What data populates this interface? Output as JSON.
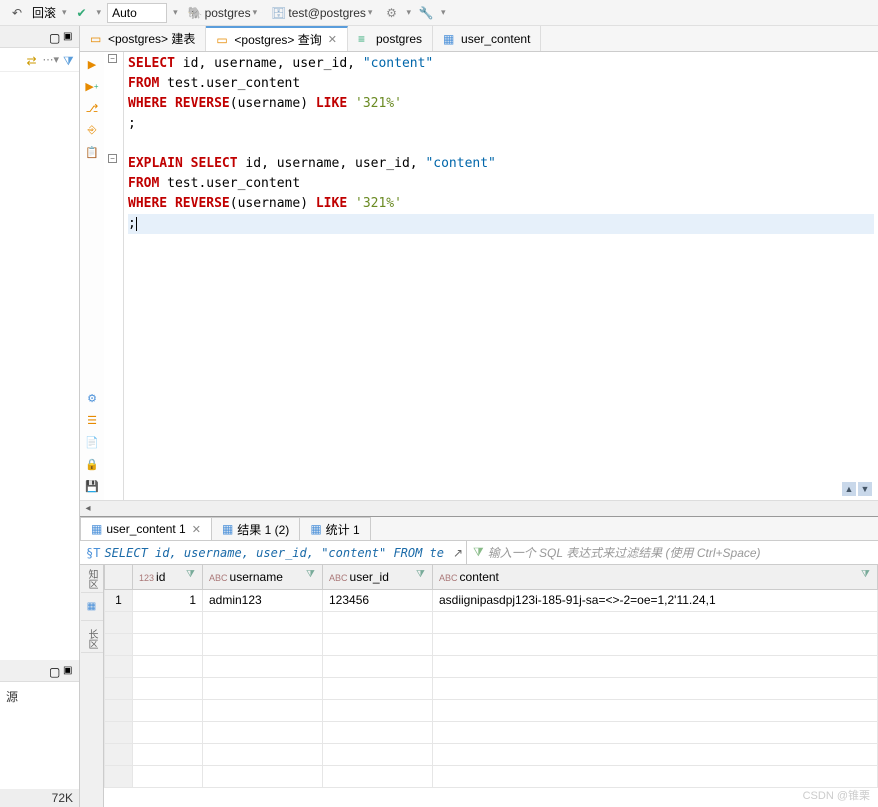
{
  "toolbar": {
    "rollback_label": "回滚",
    "combo_value": "Auto",
    "db_label": "postgres",
    "conn_label": "test@postgres"
  },
  "left": {
    "stat": "72K",
    "bottom_label": "源"
  },
  "tabs": [
    {
      "label": "<postgres> 建表",
      "active": false,
      "closeable": false
    },
    {
      "label": "<postgres> 查询",
      "active": true,
      "closeable": true
    },
    {
      "label": "postgres",
      "active": false,
      "closeable": false
    },
    {
      "label": "user_content",
      "active": false,
      "closeable": false
    }
  ],
  "sql": {
    "lines": [
      {
        "type": "sql1",
        "tokens": [
          "SELECT",
          " id, username, user_id, ",
          "\"content\""
        ]
      },
      {
        "type": "sql1b",
        "tokens": [
          "FROM",
          " test.user_content"
        ]
      },
      {
        "type": "sql1c",
        "tokens": [
          "WHERE",
          " ",
          "REVERSE",
          "(username) ",
          "LIKE",
          " ",
          "'321%'"
        ]
      },
      {
        "type": "semi",
        "tokens": [
          ";"
        ]
      },
      {
        "type": "blank"
      },
      {
        "type": "sql2",
        "tokens": [
          "EXPLAIN",
          " ",
          "SELECT",
          " id, username, user_id, ",
          "\"content\""
        ]
      },
      {
        "type": "sql2b",
        "tokens": [
          "FROM",
          " test.user_content"
        ]
      },
      {
        "type": "sql2c",
        "tokens": [
          "WHERE",
          " ",
          "REVERSE",
          "(username) ",
          "LIKE",
          " ",
          "'321%'"
        ]
      },
      {
        "type": "semi2",
        "tokens": [
          ";"
        ]
      }
    ]
  },
  "results": {
    "tabs": [
      {
        "label": "user_content 1",
        "active": true,
        "closeable": true
      },
      {
        "label": "结果 1 (2)",
        "active": false
      },
      {
        "label": "统计 1",
        "active": false
      }
    ],
    "sql_preview": "SELECT id, username, user_id, \"content\" FROM te",
    "filter_placeholder": "输入一个 SQL 表达式来过滤结果 (使用 Ctrl+Space)",
    "leftbar": {
      "btn1": "知区",
      "btn2": "长区"
    },
    "columns": [
      {
        "name": "id",
        "type": "123"
      },
      {
        "name": "username",
        "type": "ABC"
      },
      {
        "name": "user_id",
        "type": "ABC"
      },
      {
        "name": "content",
        "type": "ABC"
      }
    ],
    "rows": [
      {
        "n": "1",
        "id": "1",
        "username": "admin123",
        "user_id": "123456",
        "content": "asdiignipasdpj123i-185-91j-sa=<>-2=oe=1,2'11.24,1"
      }
    ]
  },
  "watermark": "CSDN @锥栗"
}
